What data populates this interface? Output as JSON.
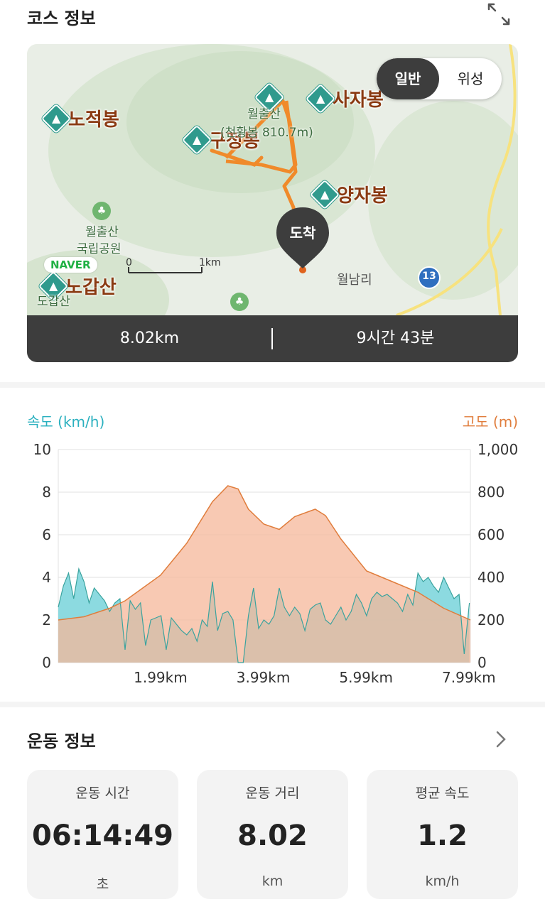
{
  "course": {
    "title": "코스 정보",
    "map": {
      "mode_options": [
        "일반",
        "위성"
      ],
      "mode_selected": "일반",
      "peaks": [
        {
          "name": "노적봉"
        },
        {
          "name": "구정봉"
        },
        {
          "name": "사자봉"
        },
        {
          "name": "양자봉"
        },
        {
          "name": "노갑산"
        }
      ],
      "summit_label": "월출산",
      "summit_sub": "(천황봉 810.7m)",
      "park_label_1": "월출산",
      "park_label_2": "국립공원",
      "village": "월남리",
      "road_number": "13",
      "scale_start": "0",
      "scale_end": "1km",
      "arrival_label": "도착",
      "naver_logo": "NAVER",
      "peak_small": "도갑산",
      "distance": "8.02km",
      "duration": "9시간 43분"
    }
  },
  "chart_legend": {
    "left": "속도 (km/h)",
    "right": "고도 (m)"
  },
  "chart_data": {
    "type": "area",
    "x_tick_labels": [
      "1.99km",
      "3.99km",
      "5.99km",
      "7.99km"
    ],
    "y_left_ticks": [
      "10",
      "8",
      "6",
      "4",
      "2",
      "0"
    ],
    "y_right_ticks": [
      "1,000",
      "800",
      "600",
      "400",
      "200",
      "0"
    ],
    "ylim_left": [
      0,
      10
    ],
    "ylim_right": [
      0,
      1000
    ],
    "xlim": [
      0,
      8.02
    ],
    "colors": {
      "elevation": "#f5b79a",
      "elevation_line": "#e07d3c",
      "speed": "#7fd6dd",
      "speed_line": "#3aa39e"
    },
    "series": [
      {
        "name": "고도",
        "x": [
          0,
          0.5,
          1.0,
          1.3,
          1.99,
          2.5,
          3.0,
          3.3,
          3.5,
          3.7,
          4.0,
          4.3,
          4.6,
          5.0,
          5.2,
          5.5,
          6.0,
          6.5,
          7.0,
          7.5,
          8.02
        ],
        "values": [
          200,
          215,
          255,
          290,
          410,
          560,
          755,
          830,
          815,
          720,
          650,
          625,
          685,
          720,
          690,
          580,
          430,
          380,
          330,
          255,
          200
        ]
      },
      {
        "name": "속도",
        "x": [
          0,
          0.1,
          0.2,
          0.3,
          0.4,
          0.5,
          0.6,
          0.7,
          0.8,
          0.9,
          1.0,
          1.1,
          1.2,
          1.3,
          1.4,
          1.5,
          1.6,
          1.7,
          1.8,
          1.9,
          2.0,
          2.1,
          2.2,
          2.3,
          2.4,
          2.5,
          2.6,
          2.7,
          2.8,
          2.9,
          3.0,
          3.1,
          3.2,
          3.3,
          3.4,
          3.5,
          3.6,
          3.7,
          3.8,
          3.9,
          4.0,
          4.1,
          4.2,
          4.3,
          4.4,
          4.5,
          4.6,
          4.7,
          4.8,
          4.9,
          5.0,
          5.1,
          5.2,
          5.3,
          5.4,
          5.5,
          5.6,
          5.7,
          5.8,
          5.9,
          6.0,
          6.1,
          6.2,
          6.3,
          6.4,
          6.5,
          6.6,
          6.7,
          6.8,
          6.9,
          7.0,
          7.1,
          7.2,
          7.3,
          7.4,
          7.5,
          7.6,
          7.7,
          7.8,
          7.9,
          8.0
        ],
        "values": [
          2.6,
          3.6,
          4.2,
          3.0,
          4.4,
          3.8,
          2.8,
          3.5,
          3.2,
          2.9,
          2.4,
          2.8,
          3.0,
          0.6,
          2.9,
          2.5,
          2.8,
          0.8,
          2.0,
          2.1,
          2.2,
          0.6,
          2.1,
          1.8,
          1.5,
          1.3,
          1.6,
          1.0,
          2.0,
          1.7,
          3.8,
          1.5,
          2.3,
          2.4,
          2.0,
          0.0,
          0.0,
          2.2,
          3.5,
          1.6,
          2.0,
          1.8,
          2.2,
          3.5,
          2.6,
          2.2,
          2.6,
          2.3,
          1.5,
          2.5,
          2.7,
          2.8,
          2.0,
          1.8,
          2.2,
          2.6,
          2.0,
          2.4,
          3.2,
          2.8,
          2.2,
          3.0,
          3.3,
          3.1,
          3.2,
          3.0,
          2.8,
          2.4,
          3.2,
          2.7,
          4.2,
          3.8,
          4.0,
          3.6,
          3.3,
          4.0,
          3.5,
          3.0,
          3.2,
          0.4,
          2.8
        ]
      }
    ]
  },
  "exercise": {
    "title": "운동 정보",
    "cards": [
      {
        "label": "운동 시간",
        "value": "06:14:49",
        "unit": "초"
      },
      {
        "label": "운동 거리",
        "value": "8.02",
        "unit": "km"
      },
      {
        "label": "평균 속도",
        "value": "1.2",
        "unit": "km/h"
      }
    ]
  }
}
